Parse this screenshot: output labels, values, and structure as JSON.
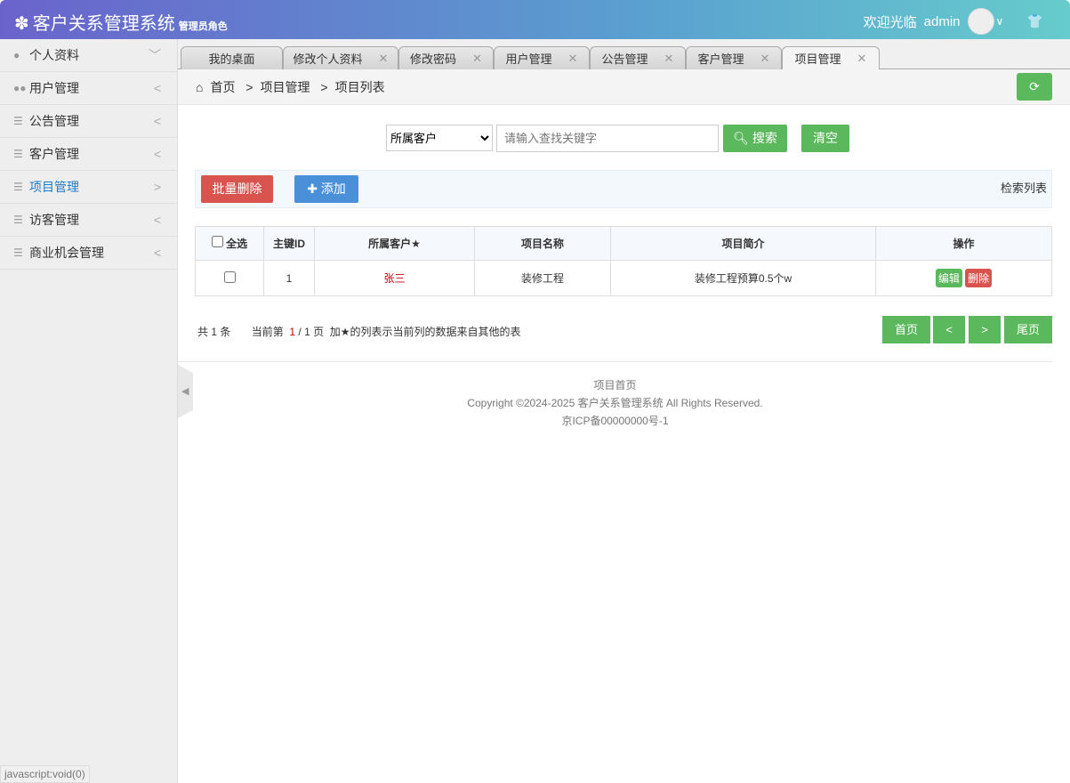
{
  "header": {
    "title": "客户关系管理系统",
    "role": "管理员角色",
    "welcome": "欢迎光临",
    "user": "admin"
  },
  "sidebar": {
    "items": [
      {
        "label": "个人资料",
        "arrow": "﹀"
      },
      {
        "label": "用户管理",
        "arrow": "<"
      },
      {
        "label": "公告管理",
        "arrow": "<"
      },
      {
        "label": "客户管理",
        "arrow": "<"
      },
      {
        "label": "项目管理",
        "arrow": ">"
      },
      {
        "label": "访客管理",
        "arrow": "<"
      },
      {
        "label": "商业机会管理",
        "arrow": "<"
      }
    ]
  },
  "status_bar": "javascript:void(0)",
  "tabs": [
    "我的桌面",
    "修改个人资料",
    "修改密码",
    "用户管理",
    "公告管理",
    "客户管理",
    "项目管理"
  ],
  "breadcrumb": [
    "首页",
    "项目管理",
    "项目列表"
  ],
  "search": {
    "select": "所属客户",
    "placeholder": "请输入查找关键字",
    "search_label": "搜索",
    "clear_label": "清空"
  },
  "toolbar": {
    "batch_delete": "批量删除",
    "add": "添加",
    "title": "检索列表"
  },
  "table": {
    "headers": [
      "全选",
      "主键ID",
      "所属客户★",
      "项目名称",
      "项目简介",
      "操作"
    ],
    "rows": [
      {
        "id": "1",
        "customer": "张三",
        "name": "装修工程",
        "desc": "装修工程预算0.5个w"
      }
    ],
    "edit": "编辑",
    "delete": "删除"
  },
  "pagination": {
    "total": "共 1 条",
    "current_prefix": "当前第",
    "current": "1",
    "total_pages": "/ 1 页",
    "note": "加★的列表示当前列的数据来自其他的表",
    "first": "首页",
    "prev": "<",
    "next": ">",
    "last": "尾页"
  },
  "footer": {
    "link": "项目首页",
    "copyright": "Copyright ©2024-2025 客户关系管理系统 All Rights Reserved.",
    "icp": "京ICP备00000000号-1"
  }
}
